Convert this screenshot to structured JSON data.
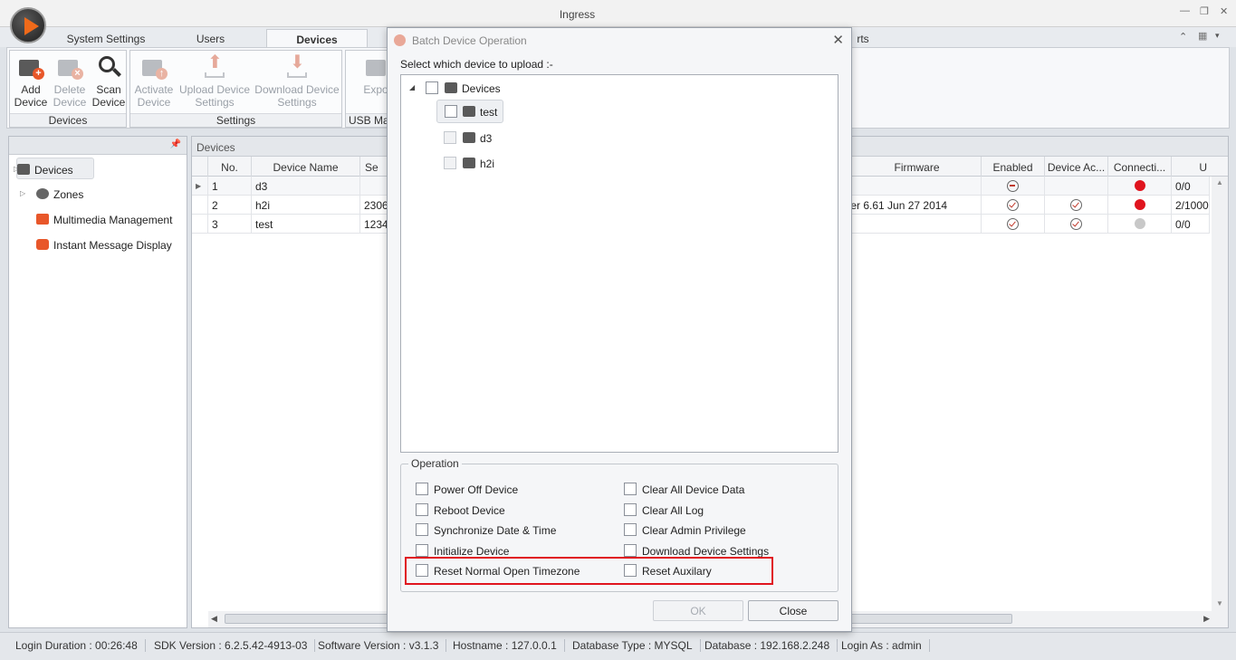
{
  "app": {
    "title": "Ingress"
  },
  "tabs": [
    {
      "label": "System Settings"
    },
    {
      "label": "Users"
    },
    {
      "label": "Devices"
    },
    {
      "label": "rts"
    }
  ],
  "ribbon": {
    "groups": [
      {
        "label": "Devices",
        "buttons": [
          {
            "line1": "Add",
            "line2": "Device"
          },
          {
            "line1": "Delete",
            "line2": "Device"
          },
          {
            "line1": "Scan",
            "line2": "Device"
          }
        ]
      },
      {
        "label": "Settings",
        "buttons": [
          {
            "line1": "Activate",
            "line2": "Device"
          },
          {
            "line1": "Upload Device",
            "line2": "Settings"
          },
          {
            "line1": "Download Device",
            "line2": "Settings"
          }
        ]
      },
      {
        "label": "USB Ma",
        "buttons": [
          {
            "line1": "Expor",
            "line2": ""
          }
        ]
      }
    ]
  },
  "sidebar": {
    "items": [
      {
        "label": "Devices",
        "icon": "device-icon"
      },
      {
        "label": "Zones",
        "icon": "globe-icon"
      },
      {
        "label": "Multimedia Management",
        "icon": "film-icon"
      },
      {
        "label": "Instant Message Display",
        "icon": "message-icon"
      }
    ]
  },
  "grid": {
    "caption": "Devices",
    "headers": {
      "no": "No.",
      "name": "Device Name",
      "serial": "Se",
      "firmware": "Firmware",
      "enabled": "Enabled",
      "access": "Device Ac...",
      "connection": "Connecti...",
      "last": "U"
    },
    "rows": [
      {
        "no": "1",
        "name": "d3",
        "serial": "",
        "firmware": "",
        "enabled": "minus",
        "access": "",
        "connection": "#e0141e",
        "count": "0/0"
      },
      {
        "no": "2",
        "name": "h2i",
        "serial": "2306",
        "firmware": "Ver 6.61 Jun 27 2014",
        "enabled": "check",
        "access": "check",
        "connection": "#e0141e",
        "count": "2/1000"
      },
      {
        "no": "3",
        "name": "test",
        "serial": "1234",
        "firmware": "",
        "enabled": "check",
        "access": "check",
        "connection": "#c8c8c8",
        "count": "0/0"
      }
    ]
  },
  "statusbar": {
    "login_duration": "Login Duration : 00:26:48",
    "sdk_version": "SDK Version : 6.2.5.42-4913-03",
    "software_version": "Software Version : v3.1.3",
    "hostname": "Hostname : 127.0.0.1",
    "db_type": "Database Type : MYSQL",
    "database": "Database : 192.168.2.248",
    "login_as": "Login As : admin"
  },
  "dialog": {
    "title": "Batch Device Operation",
    "prompt": "Select which device to upload :-",
    "tree": {
      "root": "Devices",
      "children": [
        "test",
        "d3",
        "h2i"
      ]
    },
    "operation_label": "Operation",
    "options_left": [
      "Power Off Device",
      "Reboot Device",
      "Synchronize Date & Time",
      "Initialize Device",
      "Reset Normal Open Timezone"
    ],
    "options_right": [
      "Clear All Device Data",
      "Clear All Log",
      "Clear Admin Privilege",
      "Download Device Settings",
      "Reset Auxilary"
    ],
    "ok_label": "OK",
    "close_label": "Close"
  },
  "colors": {
    "accent_orange": "#f06a1a",
    "highlight_red": "#e0141e"
  }
}
